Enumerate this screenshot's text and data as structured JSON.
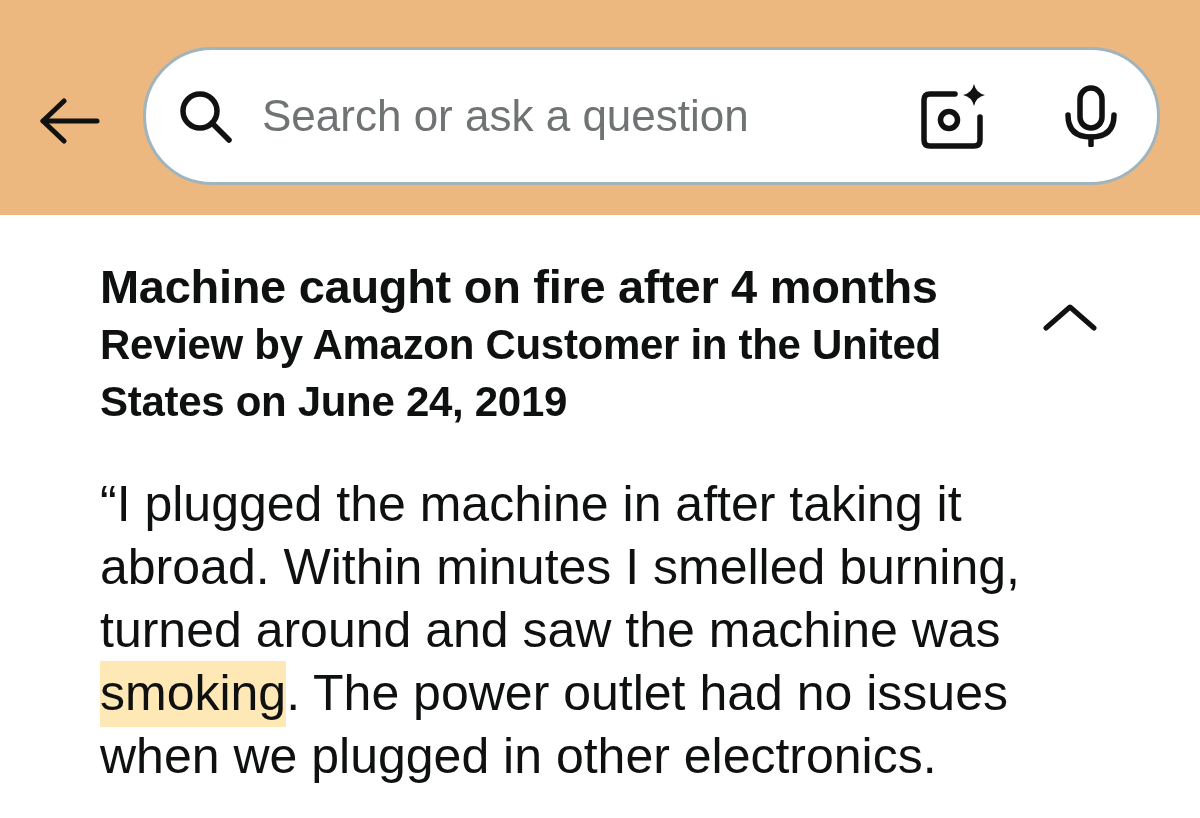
{
  "header": {
    "search": {
      "placeholder": "Search or ask a question"
    }
  },
  "review": {
    "title": "Machine caught on fire after 4 months",
    "byline": "Review by Amazon Customer in the United States on June 24, 2019",
    "expanded": true,
    "quote": [
      {
        "text": "“I plugged the machine in after taking it abroad. Within minutes I smelled burning, turned around and saw the machine was ",
        "highlighted": false
      },
      {
        "text": "smoking",
        "highlighted": true
      },
      {
        "text": ". The power outlet had no issues when we plugged in other electronics.",
        "highlighted": false
      }
    ]
  }
}
